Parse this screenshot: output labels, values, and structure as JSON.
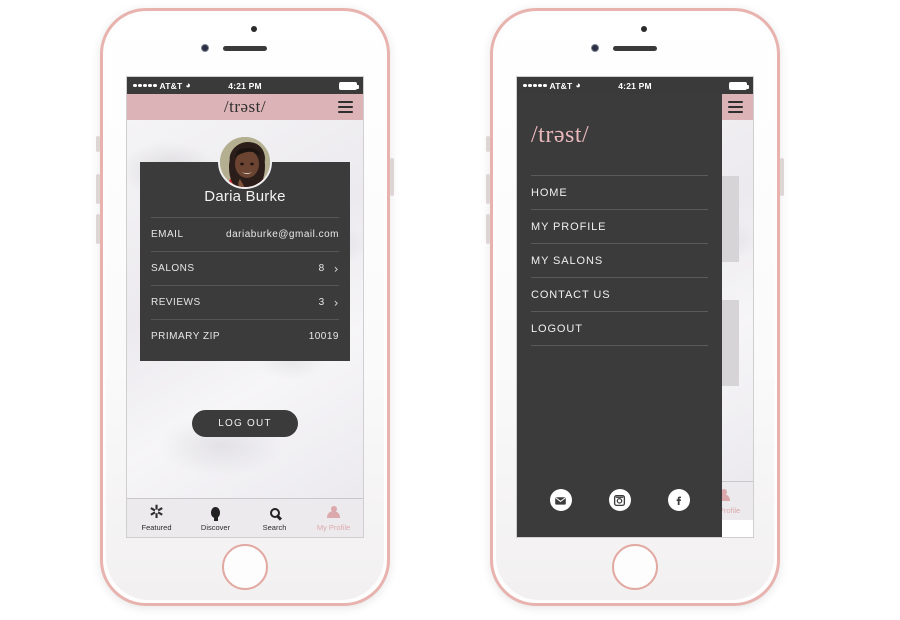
{
  "statusbar": {
    "carrier": "AT&T",
    "time": "4:21 PM",
    "wifi_icon": "wifi-icon",
    "battery_icon": "battery-icon",
    "signal_icon": "signal-dots-icon"
  },
  "header": {
    "logo": "/trəst/",
    "menu_icon": "hamburger-menu-icon"
  },
  "profile": {
    "avatar_alt": "avatar",
    "name": "Daria Burke",
    "rows": [
      {
        "label": "EMAIL",
        "value": "dariaburke@gmail.com",
        "chevron": false
      },
      {
        "label": "SALONS",
        "value": "8",
        "chevron": true
      },
      {
        "label": "REVIEWS",
        "value": "3",
        "chevron": true
      },
      {
        "label": "PRIMARY ZIP",
        "value": "10019",
        "chevron": false
      }
    ],
    "chevron_glyph": "›",
    "logout_label": "LOG OUT"
  },
  "tabbar": {
    "tabs": [
      {
        "label": "Featured",
        "icon": "asterisk-icon",
        "active": false
      },
      {
        "label": "Discover",
        "icon": "lightbulb-icon",
        "active": false
      },
      {
        "label": "Search",
        "icon": "search-icon",
        "active": false
      },
      {
        "label": "My Profile",
        "icon": "person-icon",
        "active": true
      }
    ],
    "asterisk_glyph": "✲"
  },
  "drawer": {
    "logo": "/trəst/",
    "items": [
      {
        "label": "HOME"
      },
      {
        "label": "MY PROFILE"
      },
      {
        "label": "MY SALONS"
      },
      {
        "label": "CONTACT US"
      },
      {
        "label": "LOGOUT"
      }
    ],
    "socials": [
      {
        "name": "email-icon"
      },
      {
        "name": "instagram-icon"
      },
      {
        "name": "facebook-icon"
      }
    ]
  },
  "colors": {
    "header_pink": "#dcb3b6",
    "dark_card": "#3b3b3b",
    "accent_pink": "#e9b8bb",
    "bezel_rose_gold": "#e8b3ae",
    "statusbar": "#3a3a3a"
  }
}
